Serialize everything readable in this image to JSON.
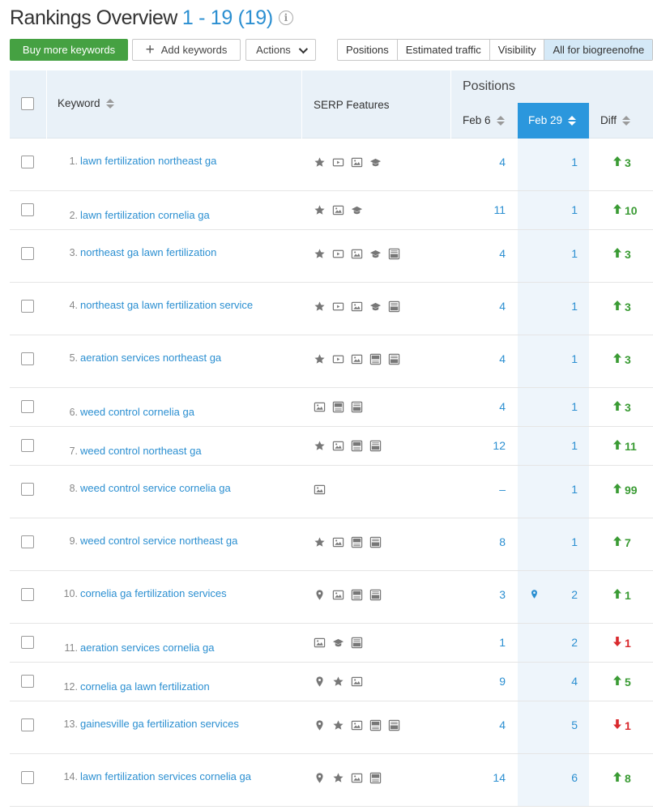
{
  "page": {
    "title": "Rankings Overview",
    "range": "1 - 19 (19)",
    "info_icon": "info-icon"
  },
  "toolbar": {
    "buy_label": "Buy more keywords",
    "add_label": "Add keywords",
    "actions_label": "Actions",
    "tabs": [
      {
        "label": "Positions",
        "active": false
      },
      {
        "label": "Estimated traffic",
        "active": false
      },
      {
        "label": "Visibility",
        "active": false
      },
      {
        "label": "All for biogreenofne",
        "active": true
      }
    ]
  },
  "table": {
    "headers": {
      "keyword": "Keyword",
      "serp": "SERP Features",
      "positions": "Positions",
      "feb6": "Feb 6",
      "feb29": "Feb 29",
      "diff": "Diff"
    },
    "rows": [
      {
        "num": "1.",
        "keyword": "lawn fertilization northeast ga",
        "serp": [
          "star-icon",
          "video-icon",
          "image-icon",
          "knowledge-icon"
        ],
        "feb6": "4",
        "feb29": "1",
        "diff": "3",
        "dir": "up",
        "pin": false
      },
      {
        "num": "2.",
        "keyword": "lawn fertilization cornelia ga",
        "serp": [
          "star-icon",
          "image-icon",
          "knowledge-icon"
        ],
        "feb6": "11",
        "feb29": "1",
        "diff": "10",
        "dir": "up",
        "pin": false
      },
      {
        "num": "3.",
        "keyword": "northeast ga lawn fertilization",
        "serp": [
          "star-icon",
          "video-icon",
          "image-icon",
          "knowledge-icon",
          "ad-bottom-icon"
        ],
        "feb6": "4",
        "feb29": "1",
        "diff": "3",
        "dir": "up",
        "pin": false
      },
      {
        "num": "4.",
        "keyword": "northeast ga lawn fertilization service",
        "serp": [
          "star-icon",
          "video-icon",
          "image-icon",
          "knowledge-icon",
          "ad-bottom-icon"
        ],
        "feb6": "4",
        "feb29": "1",
        "diff": "3",
        "dir": "up",
        "pin": false
      },
      {
        "num": "5.",
        "keyword": "aeration services northeast ga",
        "serp": [
          "star-icon",
          "video-icon",
          "image-icon",
          "ad-top-icon",
          "ad-bottom-icon"
        ],
        "feb6": "4",
        "feb29": "1",
        "diff": "3",
        "dir": "up",
        "pin": false
      },
      {
        "num": "6.",
        "keyword": "weed control cornelia ga",
        "serp": [
          "image-icon",
          "ad-top-icon",
          "ad-bottom-icon"
        ],
        "feb6": "4",
        "feb29": "1",
        "diff": "3",
        "dir": "up",
        "pin": false
      },
      {
        "num": "7.",
        "keyword": "weed control northeast ga",
        "serp": [
          "star-icon",
          "image-icon",
          "ad-top-icon",
          "ad-bottom-icon"
        ],
        "feb6": "12",
        "feb29": "1",
        "diff": "11",
        "dir": "up",
        "pin": false
      },
      {
        "num": "8.",
        "keyword": "weed control service cornelia ga",
        "serp": [
          "image-icon"
        ],
        "feb6": "–",
        "feb29": "1",
        "diff": "99",
        "dir": "up",
        "pin": false
      },
      {
        "num": "9.",
        "keyword": "weed control service northeast ga",
        "serp": [
          "star-icon",
          "image-icon",
          "ad-top-icon",
          "ad-bottom-icon"
        ],
        "feb6": "8",
        "feb29": "1",
        "diff": "7",
        "dir": "up",
        "pin": false
      },
      {
        "num": "10.",
        "keyword": "cornelia ga fertilization services",
        "serp": [
          "pin-icon",
          "image-icon",
          "ad-top-icon",
          "ad-bottom-icon"
        ],
        "feb6": "3",
        "feb29": "2",
        "diff": "1",
        "dir": "up",
        "pin": true
      },
      {
        "num": "11.",
        "keyword": "aeration services cornelia ga",
        "serp": [
          "image-icon",
          "knowledge-icon",
          "ad-bottom-icon"
        ],
        "feb6": "1",
        "feb29": "2",
        "diff": "1",
        "dir": "down",
        "pin": false
      },
      {
        "num": "12.",
        "keyword": "cornelia ga lawn fertilization",
        "serp": [
          "pin-icon",
          "star-icon",
          "image-icon"
        ],
        "feb6": "9",
        "feb29": "4",
        "diff": "5",
        "dir": "up",
        "pin": false
      },
      {
        "num": "13.",
        "keyword": "gainesville ga fertilization services",
        "serp": [
          "pin-icon",
          "star-icon",
          "image-icon",
          "ad-top-icon",
          "ad-bottom-icon"
        ],
        "feb6": "4",
        "feb29": "5",
        "diff": "1",
        "dir": "down",
        "pin": false
      },
      {
        "num": "14.",
        "keyword": "lawn fertilization services cornelia ga",
        "serp": [
          "pin-icon",
          "star-icon",
          "image-icon",
          "ad-top-icon"
        ],
        "feb6": "14",
        "feb29": "6",
        "diff": "8",
        "dir": "up",
        "pin": false
      }
    ]
  },
  "colors": {
    "accent": "#2b8fd1",
    "buy_green": "#45a142",
    "up_green": "#3a9b34",
    "down_red": "#d9292d",
    "header_bg": "#e9f1f8",
    "active_col": "#2b97dd"
  }
}
